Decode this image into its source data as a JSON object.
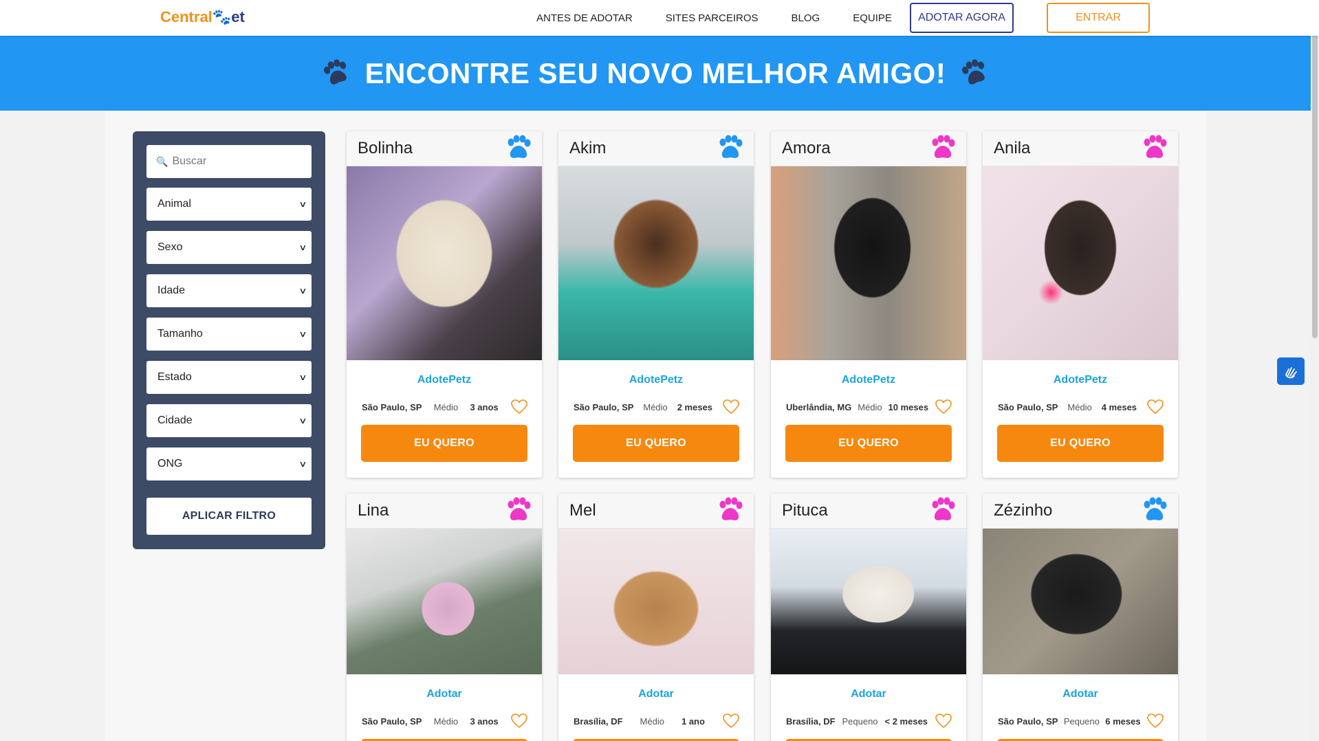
{
  "header": {
    "logo_main": "Central",
    "logo_accent": "et",
    "nav": [
      "ANTES DE ADOTAR",
      "SITES PARCEIROS",
      "BLOG",
      "EQUIPE"
    ],
    "adopt_button": "ADOTAR AGORA",
    "login_button": "ENTRAR"
  },
  "hero": {
    "title": "ENCONTRE SEU NOVO MELHOR AMIGO!",
    "icon": "paw-icon"
  },
  "filter": {
    "search_placeholder": "Buscar",
    "selects": [
      "Animal",
      "Sexo",
      "Idade",
      "Tamanho",
      "Estado",
      "Cidade",
      "ONG"
    ],
    "apply_button": "APLICAR FILTRO"
  },
  "colors": {
    "primary_blue": "#2196f3",
    "orange": "#f7880f",
    "navy": "#2d3a8c",
    "male_paw": "#2196f3",
    "female_paw": "#ee37c8",
    "sidebar": "#3d4b66"
  },
  "pets": [
    {
      "name": "Bolinha",
      "sex_icon": "male",
      "org": "AdotePetz",
      "location": "São Paulo, SP",
      "size": "Médio",
      "age": "3 anos",
      "button": "EU QUERO"
    },
    {
      "name": "Akim",
      "sex_icon": "male",
      "org": "AdotePetz",
      "location": "São Paulo, SP",
      "size": "Médio",
      "age": "2 meses",
      "button": "EU QUERO"
    },
    {
      "name": "Amora",
      "sex_icon": "female",
      "org": "AdotePetz",
      "location": "Uberlândia, MG",
      "size": "Médio",
      "age": "10 meses",
      "button": "EU QUERO"
    },
    {
      "name": "Anila",
      "sex_icon": "female",
      "org": "AdotePetz",
      "location": "São Paulo, SP",
      "size": "Médio",
      "age": "4 meses",
      "button": "EU QUERO"
    },
    {
      "name": "Lina",
      "sex_icon": "female",
      "org": "Adotar",
      "location": "São Paulo, SP",
      "size": "Médio",
      "age": "3 anos",
      "button": ""
    },
    {
      "name": "Mel",
      "sex_icon": "female",
      "org": "Adotar",
      "location": "Brasília, DF",
      "size": "Médio",
      "age": "1 ano",
      "button": ""
    },
    {
      "name": "Pituca",
      "sex_icon": "female",
      "org": "Adotar",
      "location": "Brasília, DF",
      "size": "Pequeno",
      "age": "< 2 meses",
      "button": ""
    },
    {
      "name": "Zézinho",
      "sex_icon": "male",
      "org": "Adotar",
      "location": "São Paulo, SP",
      "size": "Pequeno",
      "age": "6 meses",
      "button": ""
    }
  ]
}
